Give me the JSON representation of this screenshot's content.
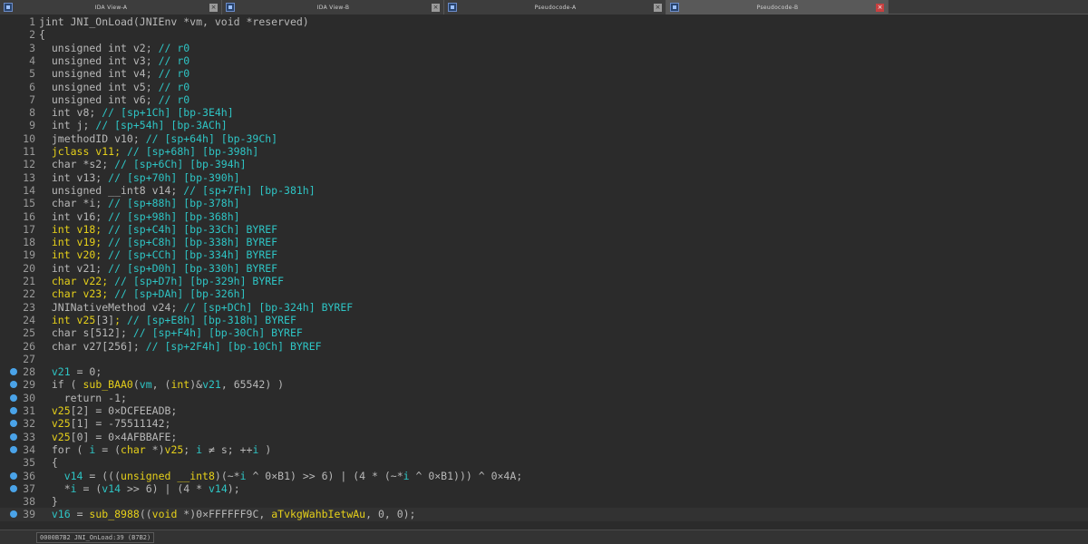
{
  "tabs": [
    {
      "label": "IDA View-A",
      "active": false
    },
    {
      "label": "IDA View-B",
      "active": false
    },
    {
      "label": "Pseudocode-A",
      "active": false
    },
    {
      "label": "Pseudocode-B",
      "active": true
    }
  ],
  "colors": {
    "type": "#b8b8b8",
    "comment": "#2ec5c5",
    "highlight": "#e6d01a",
    "breakpoint_dot": "#4aa3e8"
  },
  "lines": [
    {
      "n": "1",
      "dot": false,
      "parts": [
        [
          "jint JNI_OnLoad(JNIEnv *vm, void *reserved)",
          "t"
        ]
      ]
    },
    {
      "n": "2",
      "dot": false,
      "parts": [
        [
          "{",
          "t"
        ]
      ]
    },
    {
      "n": "3",
      "dot": false,
      "parts": [
        [
          "  unsigned int v2; ",
          "t"
        ],
        [
          "// r0",
          "c"
        ]
      ]
    },
    {
      "n": "4",
      "dot": false,
      "parts": [
        [
          "  unsigned int v3; ",
          "t"
        ],
        [
          "// r0",
          "c"
        ]
      ]
    },
    {
      "n": "5",
      "dot": false,
      "parts": [
        [
          "  unsigned int v4; ",
          "t"
        ],
        [
          "// r0",
          "c"
        ]
      ]
    },
    {
      "n": "6",
      "dot": false,
      "parts": [
        [
          "  unsigned int v5; ",
          "t"
        ],
        [
          "// r0",
          "c"
        ]
      ]
    },
    {
      "n": "7",
      "dot": false,
      "parts": [
        [
          "  unsigned int v6; ",
          "t"
        ],
        [
          "// r0",
          "c"
        ]
      ]
    },
    {
      "n": "8",
      "dot": false,
      "parts": [
        [
          "  int v8; ",
          "t"
        ],
        [
          "// [sp+1Ch] [bp-3E4h]",
          "c"
        ]
      ]
    },
    {
      "n": "9",
      "dot": false,
      "parts": [
        [
          "  int j; ",
          "t"
        ],
        [
          "// [sp+54h] [bp-3ACh]",
          "c"
        ]
      ]
    },
    {
      "n": "10",
      "dot": false,
      "parts": [
        [
          "  jmethodID v10; ",
          "t"
        ],
        [
          "// [sp+64h] [bp-39Ch]",
          "c"
        ]
      ]
    },
    {
      "n": "11",
      "dot": false,
      "parts": [
        [
          "  jclass v11; ",
          "y"
        ],
        [
          "// [sp+68h] [bp-398h]",
          "c"
        ]
      ]
    },
    {
      "n": "12",
      "dot": false,
      "parts": [
        [
          "  char *s2; ",
          "t"
        ],
        [
          "// [sp+6Ch] [bp-394h]",
          "c"
        ]
      ]
    },
    {
      "n": "13",
      "dot": false,
      "parts": [
        [
          "  int v13; ",
          "t"
        ],
        [
          "// [sp+70h] [bp-390h]",
          "c"
        ]
      ]
    },
    {
      "n": "14",
      "dot": false,
      "parts": [
        [
          "  unsigned __int8 v14; ",
          "t"
        ],
        [
          "// [sp+7Fh] [bp-381h]",
          "c"
        ]
      ]
    },
    {
      "n": "15",
      "dot": false,
      "parts": [
        [
          "  char *i; ",
          "t"
        ],
        [
          "// [sp+88h] [bp-378h]",
          "c"
        ]
      ]
    },
    {
      "n": "16",
      "dot": false,
      "parts": [
        [
          "  int v16; ",
          "t"
        ],
        [
          "// [sp+98h] [bp-368h]",
          "c"
        ]
      ]
    },
    {
      "n": "17",
      "dot": false,
      "parts": [
        [
          "  int v18; ",
          "y"
        ],
        [
          "// [sp+C4h] [bp-33Ch] BYREF",
          "c"
        ]
      ]
    },
    {
      "n": "18",
      "dot": false,
      "parts": [
        [
          "  int v19; ",
          "y"
        ],
        [
          "// [sp+C8h] [bp-338h] BYREF",
          "c"
        ]
      ]
    },
    {
      "n": "19",
      "dot": false,
      "parts": [
        [
          "  int v20; ",
          "y"
        ],
        [
          "// [sp+CCh] [bp-334h] BYREF",
          "c"
        ]
      ]
    },
    {
      "n": "20",
      "dot": false,
      "parts": [
        [
          "  int v21; ",
          "t"
        ],
        [
          "// [sp+D0h] [bp-330h] BYREF",
          "c"
        ]
      ]
    },
    {
      "n": "21",
      "dot": false,
      "parts": [
        [
          "  char v22; ",
          "y"
        ],
        [
          "// [sp+D7h] [bp-329h] BYREF",
          "c"
        ]
      ]
    },
    {
      "n": "22",
      "dot": false,
      "parts": [
        [
          "  char v23; ",
          "y"
        ],
        [
          "// [sp+DAh] [bp-326h]",
          "c"
        ]
      ]
    },
    {
      "n": "23",
      "dot": false,
      "parts": [
        [
          "  JNINativeMethod v24; ",
          "t"
        ],
        [
          "// [sp+DCh] [bp-324h] BYREF",
          "c"
        ]
      ]
    },
    {
      "n": "24",
      "dot": false,
      "parts": [
        [
          "  int v25",
          "y"
        ],
        [
          "[3]",
          "t"
        ],
        [
          "; ",
          "y"
        ],
        [
          "// [sp+E8h] [bp-318h] BYREF",
          "c"
        ]
      ]
    },
    {
      "n": "25",
      "dot": false,
      "parts": [
        [
          "  char s[512]; ",
          "t"
        ],
        [
          "// [sp+F4h] [bp-30Ch] BYREF",
          "c"
        ]
      ]
    },
    {
      "n": "26",
      "dot": false,
      "parts": [
        [
          "  char v27[256]; ",
          "t"
        ],
        [
          "// [sp+2F4h] [bp-10Ch] BYREF",
          "c"
        ]
      ]
    },
    {
      "n": "27",
      "dot": false,
      "parts": [
        [
          "",
          "t"
        ]
      ]
    },
    {
      "n": "28",
      "dot": true,
      "parts": [
        [
          "  ",
          "t"
        ],
        [
          "v21",
          "c"
        ],
        [
          " = 0;",
          "t"
        ]
      ]
    },
    {
      "n": "29",
      "dot": true,
      "parts": [
        [
          "  if ( ",
          "t"
        ],
        [
          "sub_BAA0",
          "y"
        ],
        [
          "(",
          "t"
        ],
        [
          "vm",
          "c"
        ],
        [
          ", (",
          "t"
        ],
        [
          "int",
          "y"
        ],
        [
          ")&",
          "t"
        ],
        [
          "v21",
          "c"
        ],
        [
          ", 65542) )",
          "t"
        ]
      ]
    },
    {
      "n": "30",
      "dot": true,
      "parts": [
        [
          "    return -1;",
          "t"
        ]
      ]
    },
    {
      "n": "31",
      "dot": true,
      "parts": [
        [
          "  ",
          "t"
        ],
        [
          "v25",
          "y"
        ],
        [
          "[2] = 0×DCFEEADB;",
          "t"
        ]
      ]
    },
    {
      "n": "32",
      "dot": true,
      "parts": [
        [
          "  ",
          "t"
        ],
        [
          "v25",
          "y"
        ],
        [
          "[1] = -75511142;",
          "t"
        ]
      ]
    },
    {
      "n": "33",
      "dot": true,
      "parts": [
        [
          "  ",
          "t"
        ],
        [
          "v25",
          "y"
        ],
        [
          "[0] = 0×4AFBBAFE;",
          "t"
        ]
      ]
    },
    {
      "n": "34",
      "dot": true,
      "parts": [
        [
          "  for ( ",
          "t"
        ],
        [
          "i",
          "c"
        ],
        [
          " = (",
          "t"
        ],
        [
          "char",
          "y"
        ],
        [
          " *)",
          "t"
        ],
        [
          "v25",
          "y"
        ],
        [
          "; ",
          "t"
        ],
        [
          "i",
          "c"
        ],
        [
          " ≠ s; ++",
          "t"
        ],
        [
          "i",
          "c"
        ],
        [
          " )",
          "t"
        ]
      ]
    },
    {
      "n": "35",
      "dot": false,
      "parts": [
        [
          "  {",
          "t"
        ]
      ]
    },
    {
      "n": "36",
      "dot": true,
      "parts": [
        [
          "    ",
          "t"
        ],
        [
          "v14",
          "c"
        ],
        [
          " = (((",
          "t"
        ],
        [
          "unsigned __int8",
          "y"
        ],
        [
          ")(~*",
          "t"
        ],
        [
          "i",
          "c"
        ],
        [
          " ^ 0×B1) >> 6) | (4 * (~*",
          "t"
        ],
        [
          "i",
          "c"
        ],
        [
          " ^ 0×B1))) ^ 0×4A;",
          "t"
        ]
      ]
    },
    {
      "n": "37",
      "dot": true,
      "parts": [
        [
          "    *",
          "t"
        ],
        [
          "i",
          "c"
        ],
        [
          " = (",
          "t"
        ],
        [
          "v14",
          "c"
        ],
        [
          " >> 6) | (4 * ",
          "t"
        ],
        [
          "v14",
          "c"
        ],
        [
          ");",
          "t"
        ]
      ]
    },
    {
      "n": "38",
      "dot": false,
      "parts": [
        [
          "  }",
          "t"
        ]
      ]
    },
    {
      "n": "39",
      "dot": true,
      "parts": [
        [
          "  ",
          "t"
        ],
        [
          "v16",
          "c"
        ],
        [
          " = ",
          "t"
        ],
        [
          "sub_8988",
          "y"
        ],
        [
          "((",
          "t"
        ],
        [
          "void",
          "y"
        ],
        [
          " *)0×FFFFFF9C, ",
          "t"
        ],
        [
          "aTvkgWahbIetwAu",
          "y"
        ],
        [
          ", 0, 0);",
          "t"
        ]
      ]
    }
  ],
  "status": {
    "text": "0000B7B2 JNI_OnLoad:39 (B7B2)"
  }
}
